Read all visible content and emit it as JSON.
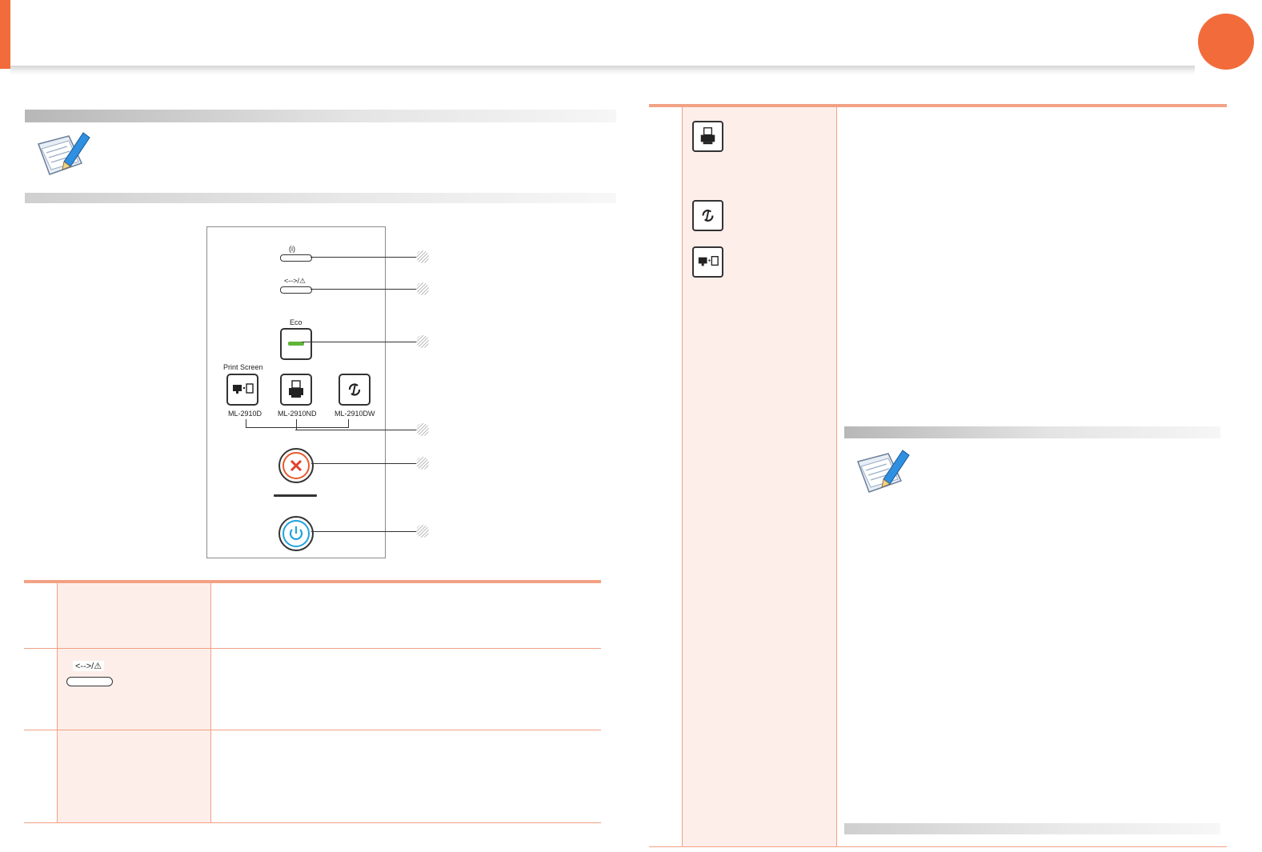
{
  "document": {
    "header_color": "#f26b3a",
    "table_rule_color": "#f2a184",
    "table_tint_color": "#fdeeea"
  },
  "panel": {
    "wireless_led_label": "(i)",
    "error_led_label": "<-->/⚠",
    "eco_label": "Eco",
    "print_screen_label": "Print Screen",
    "model_labels": [
      "ML-2910D",
      "ML-2910ND",
      "ML-2910DW"
    ]
  },
  "left_table": {
    "row2_icon_label": "<-->/⚠"
  },
  "icons": [
    "note-pencil-icon",
    "printer-info-icon",
    "wps-icon",
    "print-screen-icon",
    "cancel-icon",
    "power-icon",
    "eco-icon"
  ]
}
